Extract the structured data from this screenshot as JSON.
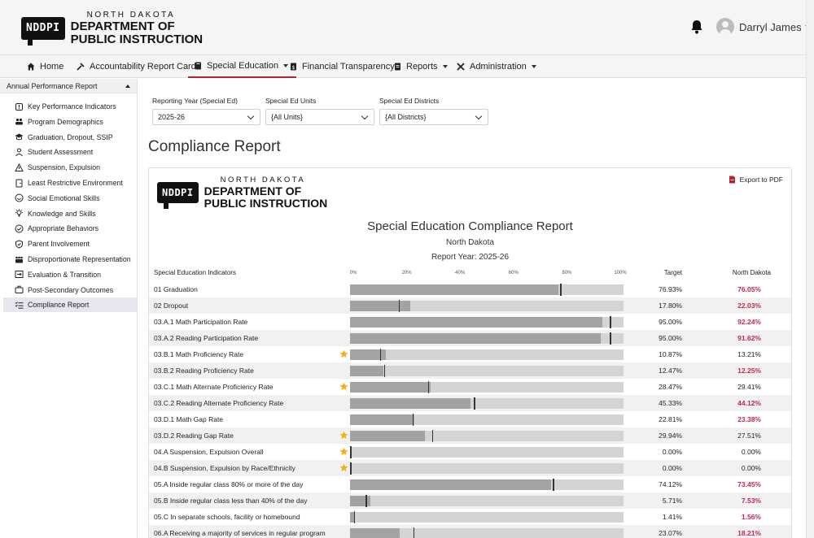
{
  "header": {
    "logo_badge": "NDDPI",
    "logo_line1": "NORTH DAKOTA",
    "logo_line2": "DEPARTMENT OF",
    "logo_line3": "PUBLIC INSTRUCTION",
    "user_name": "Darryl James"
  },
  "nav": [
    {
      "label": "Home",
      "icon": "home-icon"
    },
    {
      "label": "Accountability Report Card",
      "icon": "tools-icon"
    },
    {
      "label": "Special Education",
      "icon": "book-icon",
      "active": true,
      "dropdown": true
    },
    {
      "label": "Financial Transparency",
      "icon": "dollar-doc-icon"
    },
    {
      "label": "Reports",
      "icon": "report-icon",
      "dropdown": true
    },
    {
      "label": "Administration",
      "icon": "wrench-icon",
      "dropdown": true
    }
  ],
  "sidebar": {
    "heading": "Annual Performance Report",
    "items": [
      {
        "label": "Key Performance Indicators",
        "icon": "alert-box-icon"
      },
      {
        "label": "Program Demographics",
        "icon": "people-icon"
      },
      {
        "label": "Graduation, Dropout, SSIP",
        "icon": "graduation-cap-icon"
      },
      {
        "label": "Student Assessment",
        "icon": "student-icon"
      },
      {
        "label": "Suspension, Expulsion",
        "icon": "warning-icon"
      },
      {
        "label": "Least Restrictive Environment",
        "icon": "door-icon"
      },
      {
        "label": "Social Emotional Skills",
        "icon": "smile-icon"
      },
      {
        "label": "Knowledge and Skills",
        "icon": "lightbulb-icon"
      },
      {
        "label": "Appropriate Behaviors",
        "icon": "check-circle-icon"
      },
      {
        "label": "Parent Involvement",
        "icon": "shield-check-icon"
      },
      {
        "label": "Disproportionate Representation",
        "icon": "group-icon"
      },
      {
        "label": "Evaluation & Transition",
        "icon": "transition-icon"
      },
      {
        "label": "Post-Secondary Outcomes",
        "icon": "briefcase-icon"
      },
      {
        "label": "Compliance Report",
        "icon": "list-check-icon",
        "active": true
      }
    ]
  },
  "filters": {
    "year_label": "Reporting Year (Special Ed)",
    "year_value": "2025-26",
    "units_label": "Special Ed Units",
    "units_value": "{All Units}",
    "districts_label": "Special Ed Districts",
    "districts_value": "{All Districts}"
  },
  "page_title": "Compliance Report",
  "report": {
    "export_label": "Export to PDF",
    "title": "Special Education Compliance Report",
    "subtitle": "North Dakota",
    "year": "Report Year: 2025-26",
    "col_indicator": "Special Education Indicators",
    "col_target": "Target",
    "col_nd": "North Dakota",
    "ticks": [
      "0%",
      "20%",
      "40%",
      "60%",
      "80%",
      "100%"
    ]
  },
  "colors": {
    "accent_red": "#b5242f",
    "value_red": "#c7254e",
    "star": "#f2b01e"
  },
  "rows": [
    {
      "label": "01 Graduation",
      "star": false,
      "target": "76.93%",
      "nd": "76.05%",
      "nd_red": true,
      "target_v": 76.93,
      "nd_v": 76.05
    },
    {
      "label": "02 Dropout",
      "star": false,
      "target": "17.80%",
      "nd": "22.03%",
      "nd_red": true,
      "target_v": 17.8,
      "nd_v": 22.03
    },
    {
      "label": "03.A.1 Math Participation Rate",
      "star": false,
      "target": "95.00%",
      "nd": "92.24%",
      "nd_red": true,
      "target_v": 95.0,
      "nd_v": 92.24
    },
    {
      "label": "03.A.2 Reading Participation Rate",
      "star": false,
      "target": "95.00%",
      "nd": "91.62%",
      "nd_red": true,
      "target_v": 95.0,
      "nd_v": 91.62
    },
    {
      "label": "03.B.1 Math Proficiency Rate",
      "star": true,
      "target": "10.87%",
      "nd": "13.21%",
      "nd_red": false,
      "target_v": 10.87,
      "nd_v": 13.21
    },
    {
      "label": "03.B.2 Reading Proficiency Rate",
      "star": false,
      "target": "12.47%",
      "nd": "12.25%",
      "nd_red": true,
      "target_v": 12.47,
      "nd_v": 12.25
    },
    {
      "label": "03.C.1 Math Alternate Proficiency Rate",
      "star": true,
      "target": "28.47%",
      "nd": "29.41%",
      "nd_red": false,
      "target_v": 28.47,
      "nd_v": 29.41
    },
    {
      "label": "03.C.2 Reading Alternate Proficiency Rate",
      "star": false,
      "target": "45.33%",
      "nd": "44.12%",
      "nd_red": true,
      "target_v": 45.33,
      "nd_v": 44.12
    },
    {
      "label": "03.D.1 Math Gap Rate",
      "star": false,
      "target": "22.81%",
      "nd": "23.38%",
      "nd_red": true,
      "target_v": 22.81,
      "nd_v": 23.38
    },
    {
      "label": "03.D.2 Reading Gap Rate",
      "star": true,
      "target": "29.94%",
      "nd": "27.51%",
      "nd_red": false,
      "target_v": 29.94,
      "nd_v": 27.51
    },
    {
      "label": "04.A Suspension, Expulsion Overall",
      "star": true,
      "target": "0.00%",
      "nd": "0.00%",
      "nd_red": false,
      "target_v": 0.0,
      "nd_v": 0.0
    },
    {
      "label": "04.B Suspension, Expulsion by Race/Ethnicity",
      "star": true,
      "target": "0.00%",
      "nd": "0.00%",
      "nd_red": false,
      "target_v": 0.0,
      "nd_v": 0.0
    },
    {
      "label": "05.A Inside regular class 80% or more of the day",
      "star": false,
      "target": "74.12%",
      "nd": "73.45%",
      "nd_red": true,
      "target_v": 74.12,
      "nd_v": 73.45
    },
    {
      "label": "05.B Inside regular class less than 40% of the day",
      "star": false,
      "target": "5.71%",
      "nd": "7.53%",
      "nd_red": true,
      "target_v": 5.71,
      "nd_v": 7.53
    },
    {
      "label": "05.C In separate schools, facility or homebound",
      "star": false,
      "target": "1.41%",
      "nd": "1.56%",
      "nd_red": true,
      "target_v": 1.41,
      "nd_v": 1.56
    },
    {
      "label": "06.A Receiving a majority of services in regular program",
      "star": false,
      "target": "23.07%",
      "nd": "18.21%",
      "nd_red": true,
      "target_v": 23.07,
      "nd_v": 18.21
    }
  ]
}
